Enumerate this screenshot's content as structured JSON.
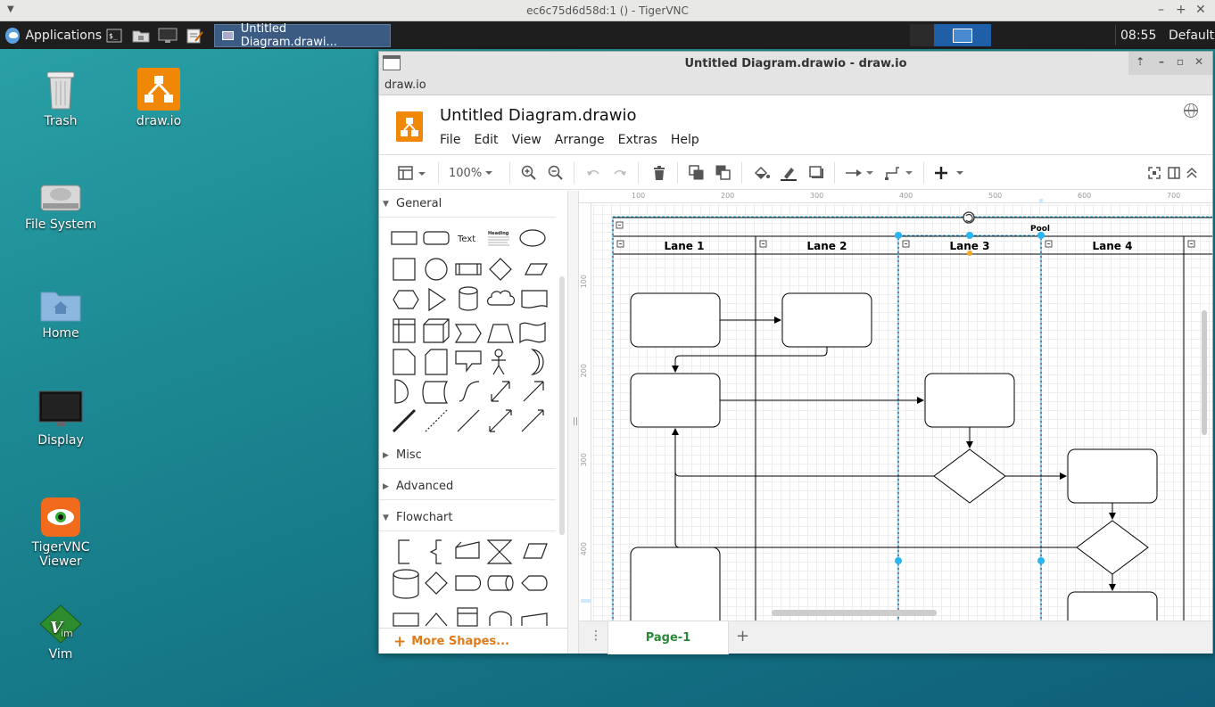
{
  "vnc": {
    "title": "ec6c75d6d58d:1 () - TigerVNC"
  },
  "taskbar": {
    "apps_label": "Applications",
    "task_title": "Untitled Diagram.drawi...",
    "clock": "08:55",
    "user": "Default"
  },
  "desktop": {
    "icons": [
      {
        "label": "Trash"
      },
      {
        "label": "draw.io"
      },
      {
        "label": "File System"
      },
      {
        "label": "Home"
      },
      {
        "label": "Display"
      },
      {
        "label": "TigerVNC\nViewer"
      },
      {
        "label": "Vim"
      }
    ]
  },
  "window": {
    "title": "Untitled Diagram.drawio - draw.io",
    "app_menu": "draw.io"
  },
  "drawio": {
    "doc_title": "Untitled Diagram.drawio",
    "menu": [
      "File",
      "Edit",
      "View",
      "Arrange",
      "Extras",
      "Help"
    ],
    "zoom": "100%",
    "sidebar": {
      "general": "General",
      "text_shape": "Text",
      "heading_shape": "Heading",
      "misc": "Misc",
      "advanced": "Advanced",
      "flowchart": "Flowchart",
      "more_shapes": "More Shapes..."
    },
    "ruler_top": [
      "100",
      "200",
      "300",
      "400",
      "500",
      "600",
      "700"
    ],
    "ruler_left": [
      "100",
      "200",
      "300",
      "400"
    ],
    "pool": {
      "label": "Pool",
      "lanes": [
        "Lane 1",
        "Lane 2",
        "Lane 3",
        "Lane 4"
      ]
    },
    "page_tab": "Page-1"
  },
  "colors": {
    "accent": "#f08705",
    "selection": "#29b6f2",
    "page_tab_text": "#2a8a3a",
    "more_shapes": "#e07a1a"
  }
}
